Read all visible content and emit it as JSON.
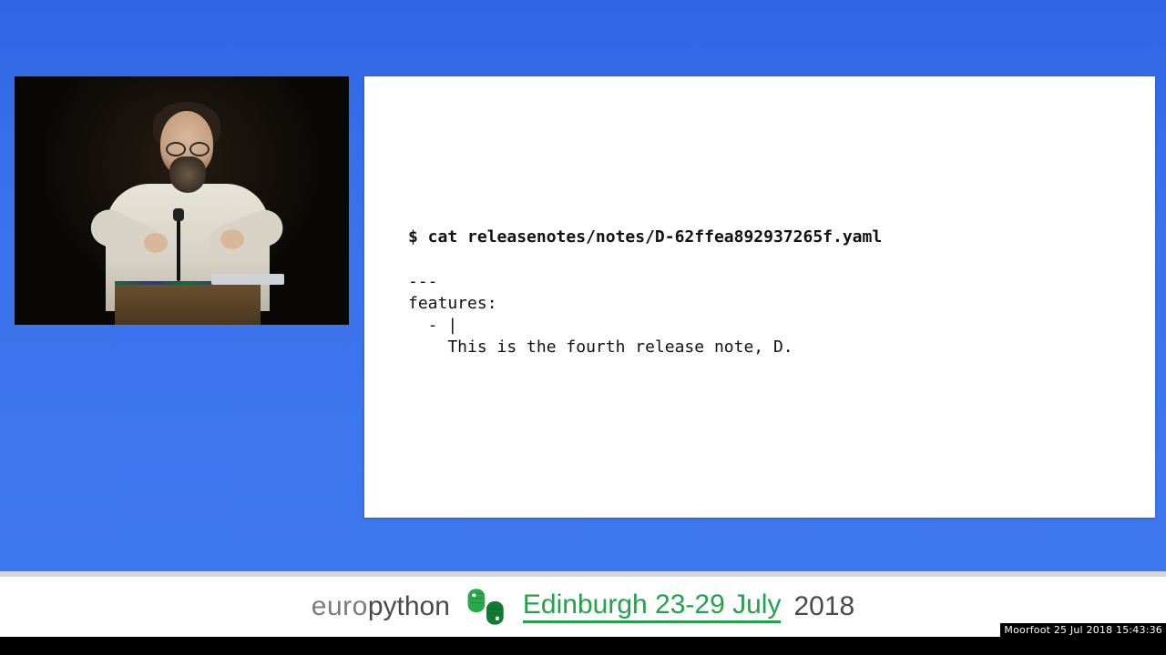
{
  "slide": {
    "command": "$ cat releasenotes/notes/D-62ffea892937265f.yaml",
    "body": "---\nfeatures:\n  - |\n    This is the fourth release note, D."
  },
  "footer": {
    "brand_prefix": "euro",
    "brand_suffix": "python",
    "location_dates": "Edinburgh 23-29 July",
    "year": "2018"
  },
  "overlay": {
    "text": "Moorfoot 25 Jul 2018 15:43:36"
  }
}
